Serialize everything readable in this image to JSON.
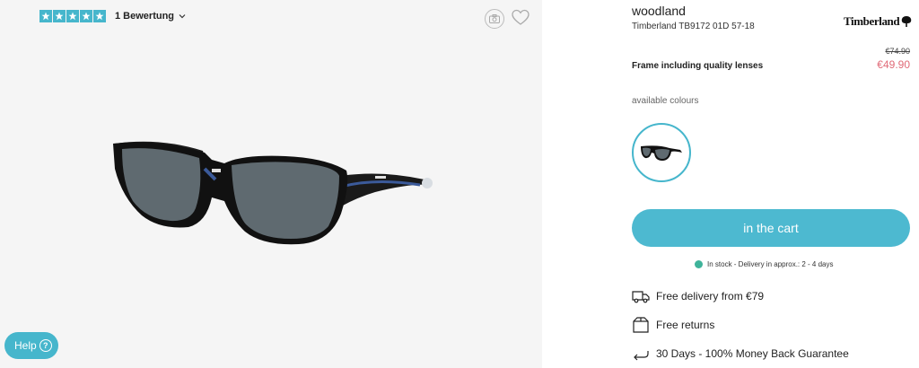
{
  "rating": {
    "stars": 5,
    "text": "1 Bewertung"
  },
  "gallery": {
    "help_label": "Help",
    "help_icon_glyph": "?"
  },
  "product": {
    "name": "woodland",
    "model": "Timberland TB9172 01D 57-18",
    "brand": "Timberland",
    "old_price": "€74.90",
    "frame_label": "Frame including quality lenses",
    "new_price": "€49.90",
    "colours_label": "available colours"
  },
  "cart": {
    "label": "in the cart"
  },
  "stock": {
    "text": "In stock - Delivery in approx.: 2 - 4 days"
  },
  "features": [
    {
      "icon": "truck-icon",
      "text": "Free delivery from €79"
    },
    {
      "icon": "box-icon",
      "text": "Free returns"
    },
    {
      "icon": "return-arrow-icon",
      "text": "30 Days - 100% Money Back Guarantee"
    }
  ],
  "colors": {
    "accent": "#46b6cc",
    "sale": "#e06a77",
    "stock": "#3fb39a"
  }
}
